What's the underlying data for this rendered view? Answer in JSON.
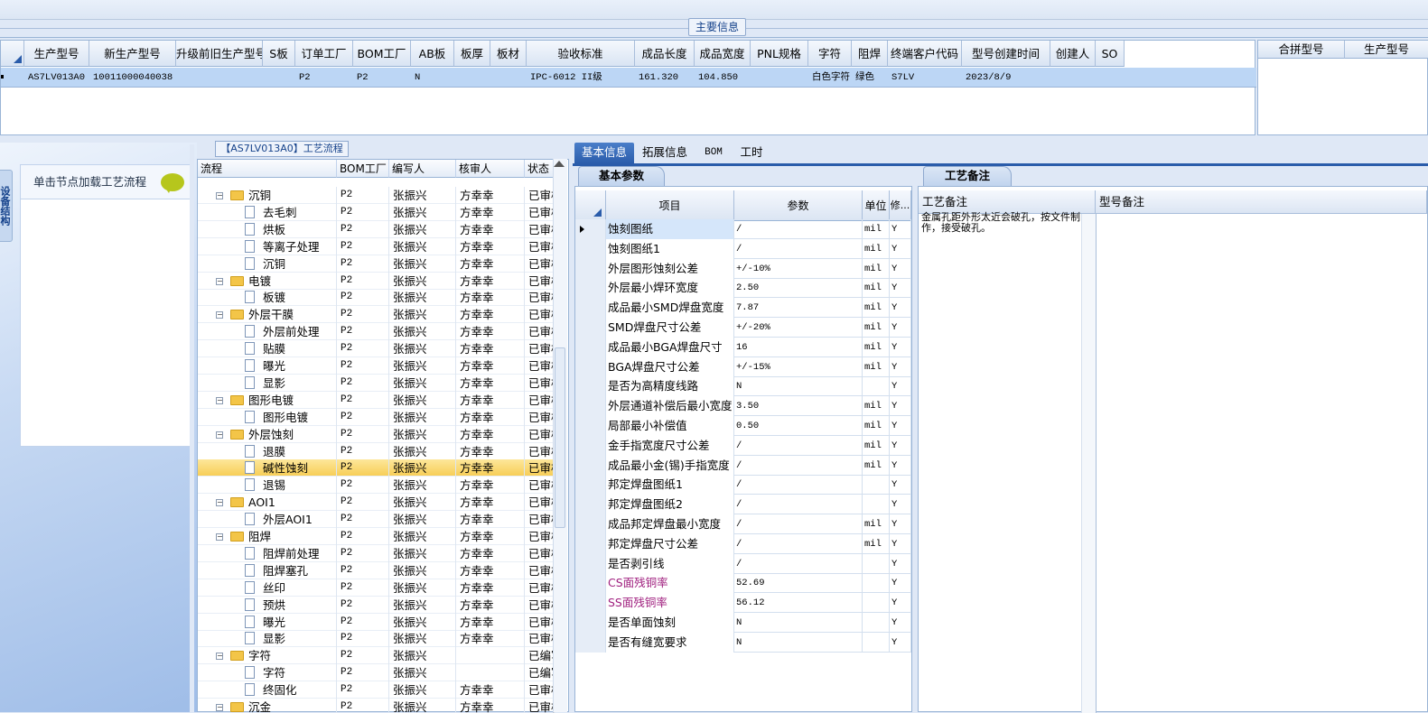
{
  "main_info": {
    "title": "主要信息",
    "headers": [
      "生产型号",
      "新生产型号",
      "升级前旧生产型号",
      "S板",
      "订单工厂",
      "BOM工厂",
      "AB板",
      "板厚",
      "板材",
      "验收标准",
      "成品长度",
      "成品宽度",
      "PNL规格",
      "字符",
      "阻焊",
      "终端客户代码",
      "型号创建时间",
      "创建人",
      "SO"
    ],
    "row": [
      "AS7LV013A0",
      "10011000040038",
      "",
      "",
      "P2",
      "P2",
      "N",
      "",
      "",
      "IPC-6012 II级",
      "161.320",
      "104.850",
      "",
      "白色字符",
      "绿色",
      "S7LV",
      "2023/8/9",
      "",
      ""
    ],
    "right_headers": [
      "合拼型号",
      "生产型号"
    ]
  },
  "side": {
    "tab_label": "设备结构",
    "load_hint": "单击节点加载工艺流程"
  },
  "tree": {
    "title": "【AS7LV013A0】工艺流程",
    "headers": [
      "流程",
      "BOM工厂",
      "编写人",
      "核审人",
      "状态"
    ],
    "rows": [
      {
        "name": "沉铜",
        "folder": true,
        "f": "P2",
        "w": "张振兴",
        "r": "方幸幸",
        "s": "已审核"
      },
      {
        "name": "去毛刺",
        "folder": false,
        "f": "P2",
        "w": "张振兴",
        "r": "方幸幸",
        "s": "已审核"
      },
      {
        "name": "烘板",
        "folder": false,
        "f": "P2",
        "w": "张振兴",
        "r": "方幸幸",
        "s": "已审核"
      },
      {
        "name": "等离子处理",
        "folder": false,
        "f": "P2",
        "w": "张振兴",
        "r": "方幸幸",
        "s": "已审核"
      },
      {
        "name": "沉铜",
        "folder": false,
        "f": "P2",
        "w": "张振兴",
        "r": "方幸幸",
        "s": "已审核"
      },
      {
        "name": "电镀",
        "folder": true,
        "f": "P2",
        "w": "张振兴",
        "r": "方幸幸",
        "s": "已审核"
      },
      {
        "name": "板镀",
        "folder": false,
        "f": "P2",
        "w": "张振兴",
        "r": "方幸幸",
        "s": "已审核"
      },
      {
        "name": "外层干膜",
        "folder": true,
        "f": "P2",
        "w": "张振兴",
        "r": "方幸幸",
        "s": "已审核"
      },
      {
        "name": "外层前处理",
        "folder": false,
        "f": "P2",
        "w": "张振兴",
        "r": "方幸幸",
        "s": "已审核"
      },
      {
        "name": "贴膜",
        "folder": false,
        "f": "P2",
        "w": "张振兴",
        "r": "方幸幸",
        "s": "已审核"
      },
      {
        "name": "曝光",
        "folder": false,
        "f": "P2",
        "w": "张振兴",
        "r": "方幸幸",
        "s": "已审核"
      },
      {
        "name": "显影",
        "folder": false,
        "f": "P2",
        "w": "张振兴",
        "r": "方幸幸",
        "s": "已审核"
      },
      {
        "name": "图形电镀",
        "folder": true,
        "f": "P2",
        "w": "张振兴",
        "r": "方幸幸",
        "s": "已审核"
      },
      {
        "name": "图形电镀",
        "folder": false,
        "f": "P2",
        "w": "张振兴",
        "r": "方幸幸",
        "s": "已审核"
      },
      {
        "name": "外层蚀刻",
        "folder": true,
        "f": "P2",
        "w": "张振兴",
        "r": "方幸幸",
        "s": "已审核"
      },
      {
        "name": "退膜",
        "folder": false,
        "f": "P2",
        "w": "张振兴",
        "r": "方幸幸",
        "s": "已审核"
      },
      {
        "name": "碱性蚀刻",
        "folder": false,
        "f": "P2",
        "w": "张振兴",
        "r": "方幸幸",
        "s": "已审核",
        "sel": true
      },
      {
        "name": "退锡",
        "folder": false,
        "f": "P2",
        "w": "张振兴",
        "r": "方幸幸",
        "s": "已审核"
      },
      {
        "name": "AOI1",
        "folder": true,
        "f": "P2",
        "w": "张振兴",
        "r": "方幸幸",
        "s": "已审核"
      },
      {
        "name": "外层AOI1",
        "folder": false,
        "f": "P2",
        "w": "张振兴",
        "r": "方幸幸",
        "s": "已审核"
      },
      {
        "name": "阻焊",
        "folder": true,
        "f": "P2",
        "w": "张振兴",
        "r": "方幸幸",
        "s": "已审核"
      },
      {
        "name": "阻焊前处理",
        "folder": false,
        "f": "P2",
        "w": "张振兴",
        "r": "方幸幸",
        "s": "已审核"
      },
      {
        "name": "阻焊塞孔",
        "folder": false,
        "f": "P2",
        "w": "张振兴",
        "r": "方幸幸",
        "s": "已审核"
      },
      {
        "name": "丝印",
        "folder": false,
        "f": "P2",
        "w": "张振兴",
        "r": "方幸幸",
        "s": "已审核"
      },
      {
        "name": "预烘",
        "folder": false,
        "f": "P2",
        "w": "张振兴",
        "r": "方幸幸",
        "s": "已审核"
      },
      {
        "name": "曝光",
        "folder": false,
        "f": "P2",
        "w": "张振兴",
        "r": "方幸幸",
        "s": "已审核"
      },
      {
        "name": "显影",
        "folder": false,
        "f": "P2",
        "w": "张振兴",
        "r": "方幸幸",
        "s": "已审核"
      },
      {
        "name": "字符",
        "folder": true,
        "f": "P2",
        "w": "张振兴",
        "r": "",
        "s": "已编写"
      },
      {
        "name": "字符",
        "folder": false,
        "f": "P2",
        "w": "张振兴",
        "r": "",
        "s": "已编写"
      },
      {
        "name": "终固化",
        "folder": false,
        "f": "P2",
        "w": "张振兴",
        "r": "方幸幸",
        "s": "已审核"
      },
      {
        "name": "沉金",
        "folder": true,
        "f": "P2",
        "w": "张振兴",
        "r": "方幸幸",
        "s": "已审核"
      }
    ]
  },
  "tabs": [
    "基本信息",
    "拓展信息",
    "BOM",
    "工时"
  ],
  "params": {
    "subtab": "基本参数",
    "headers": [
      "项目",
      "参数",
      "单位",
      "修..."
    ],
    "rows": [
      {
        "item": "蚀刻图纸",
        "val": "/",
        "unit": "mil",
        "m": "Y",
        "current": true
      },
      {
        "item": "蚀刻图纸1",
        "val": "/",
        "unit": "mil",
        "m": "Y"
      },
      {
        "item": "外层图形蚀刻公差",
        "val": "+/-10%",
        "unit": "mil",
        "m": "Y"
      },
      {
        "item": "外层最小焊环宽度",
        "val": "2.50",
        "unit": "mil",
        "m": "Y"
      },
      {
        "item": "成品最小SMD焊盘宽度",
        "val": "7.87",
        "unit": "mil",
        "m": "Y"
      },
      {
        "item": "SMD焊盘尺寸公差",
        "val": "+/-20%",
        "unit": "mil",
        "m": "Y"
      },
      {
        "item": "成品最小BGA焊盘尺寸",
        "val": "16",
        "unit": "mil",
        "m": "Y"
      },
      {
        "item": "BGA焊盘尺寸公差",
        "val": "+/-15%",
        "unit": "mil",
        "m": "Y"
      },
      {
        "item": "是否为高精度线路",
        "val": "N",
        "unit": "",
        "m": "Y"
      },
      {
        "item": "外层通道补偿后最小宽度",
        "val": "3.50",
        "unit": "mil",
        "m": "Y"
      },
      {
        "item": "局部最小补偿值",
        "val": "0.50",
        "unit": "mil",
        "m": "Y"
      },
      {
        "item": "金手指宽度尺寸公差",
        "val": "/",
        "unit": "mil",
        "m": "Y"
      },
      {
        "item": "成品最小金(锡)手指宽度",
        "val": "/",
        "unit": "mil",
        "m": "Y"
      },
      {
        "item": "邦定焊盘图纸1",
        "val": "/",
        "unit": "",
        "m": "Y"
      },
      {
        "item": "邦定焊盘图纸2",
        "val": "/",
        "unit": "",
        "m": "Y"
      },
      {
        "item": "成品邦定焊盘最小宽度",
        "val": "/",
        "unit": "mil",
        "m": "Y"
      },
      {
        "item": "邦定焊盘尺寸公差",
        "val": "/",
        "unit": "mil",
        "m": "Y"
      },
      {
        "item": "是否剥引线",
        "val": "/",
        "unit": "",
        "m": "Y"
      },
      {
        "item": "CS面残铜率",
        "val": "52.69",
        "unit": "",
        "m": "Y",
        "purple": true
      },
      {
        "item": "SS面残铜率",
        "val": "56.12",
        "unit": "",
        "m": "Y",
        "purple": true
      },
      {
        "item": "是否单面蚀刻",
        "val": "N",
        "unit": "",
        "m": "Y"
      },
      {
        "item": "是否有缝宽要求",
        "val": "N",
        "unit": "",
        "m": "Y"
      }
    ]
  },
  "remarks": {
    "tab": "工艺备注",
    "col1": "工艺备注",
    "col2": "型号备注",
    "text": "金属孔距外形太近会破孔，按文件制作，接受破孔。"
  },
  "colors": {
    "accent": "#2a5caa",
    "selected_row": "#f7ce58",
    "purple_text": "#a0207f"
  }
}
